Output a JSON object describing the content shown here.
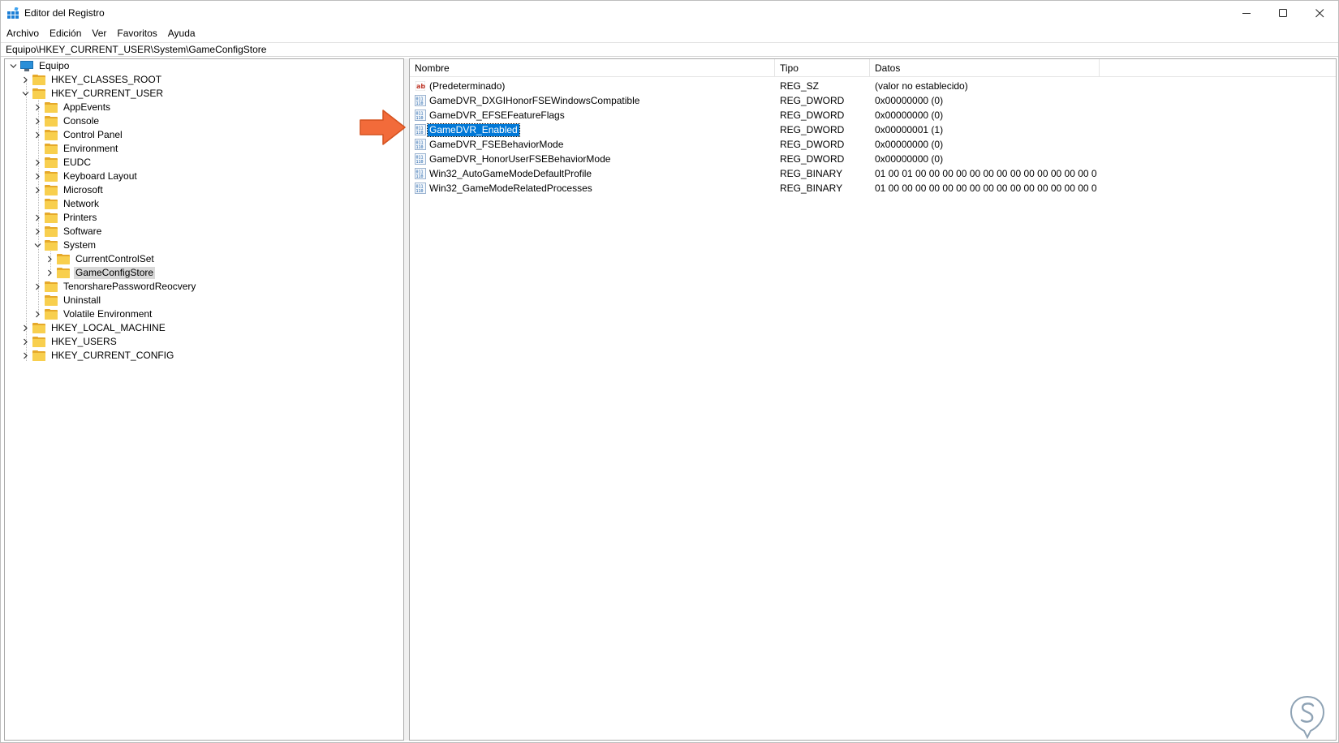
{
  "window": {
    "title": "Editor del Registro",
    "minimize_glyph": "—",
    "maximize_glyph": "☐",
    "close_glyph": "✕"
  },
  "menu": [
    "Archivo",
    "Edición",
    "Ver",
    "Favoritos",
    "Ayuda"
  ],
  "address": "Equipo\\HKEY_CURRENT_USER\\System\\GameConfigStore",
  "tree": {
    "root": "Equipo",
    "hives_top": [
      "HKEY_CLASSES_ROOT",
      "HKEY_CURRENT_USER"
    ],
    "hkcu_children": [
      "AppEvents",
      "Console",
      "Control Panel",
      "Environment",
      "EUDC",
      "Keyboard Layout",
      "Microsoft",
      "Network",
      "Printers",
      "Software",
      "System"
    ],
    "system_children": [
      "CurrentControlSet",
      "GameConfigStore"
    ],
    "hkcu_children_after": [
      "TenorsharePasswordReocvery",
      "Uninstall",
      "Volatile Environment"
    ],
    "hives_bottom": [
      "HKEY_LOCAL_MACHINE",
      "HKEY_USERS",
      "HKEY_CURRENT_CONFIG"
    ],
    "selected": "GameConfigStore"
  },
  "list": {
    "columns": {
      "name": "Nombre",
      "type": "Tipo",
      "data": "Datos"
    },
    "rows": [
      {
        "name": "(Predeterminado)",
        "type": "REG_SZ",
        "data": "(valor no establecido)",
        "icon": "string-value-icon"
      },
      {
        "name": "GameDVR_DXGIHonorFSEWindowsCompatible",
        "type": "REG_DWORD",
        "data": "0x00000000 (0)",
        "icon": "binary-value-icon"
      },
      {
        "name": "GameDVR_EFSEFeatureFlags",
        "type": "REG_DWORD",
        "data": "0x00000000 (0)",
        "icon": "binary-value-icon"
      },
      {
        "name": "GameDVR_Enabled",
        "type": "REG_DWORD",
        "data": "0x00000001 (1)",
        "icon": "binary-value-icon"
      },
      {
        "name": "GameDVR_FSEBehaviorMode",
        "type": "REG_DWORD",
        "data": "0x00000000 (0)",
        "icon": "binary-value-icon"
      },
      {
        "name": "GameDVR_HonorUserFSEBehaviorMode",
        "type": "REG_DWORD",
        "data": "0x00000000 (0)",
        "icon": "binary-value-icon"
      },
      {
        "name": "Win32_AutoGameModeDefaultProfile",
        "type": "REG_BINARY",
        "data": "01 00 01 00 00 00 00 00 00 00 00 00 00 00 00 00 00 00 00 00...",
        "icon": "binary-value-icon"
      },
      {
        "name": "Win32_GameModeRelatedProcesses",
        "type": "REG_BINARY",
        "data": "01 00 00 00 00 00 00 00 00 00 00 00 00 00 00 00 00 00 00 00...",
        "icon": "binary-value-icon"
      }
    ],
    "highlighted": "GameDVR_Enabled"
  },
  "colors": {
    "selection": "#0078d7",
    "tree_selection": "#d9d9d9",
    "folder": "#f8cf4e",
    "arrow": "#f26b3a"
  }
}
